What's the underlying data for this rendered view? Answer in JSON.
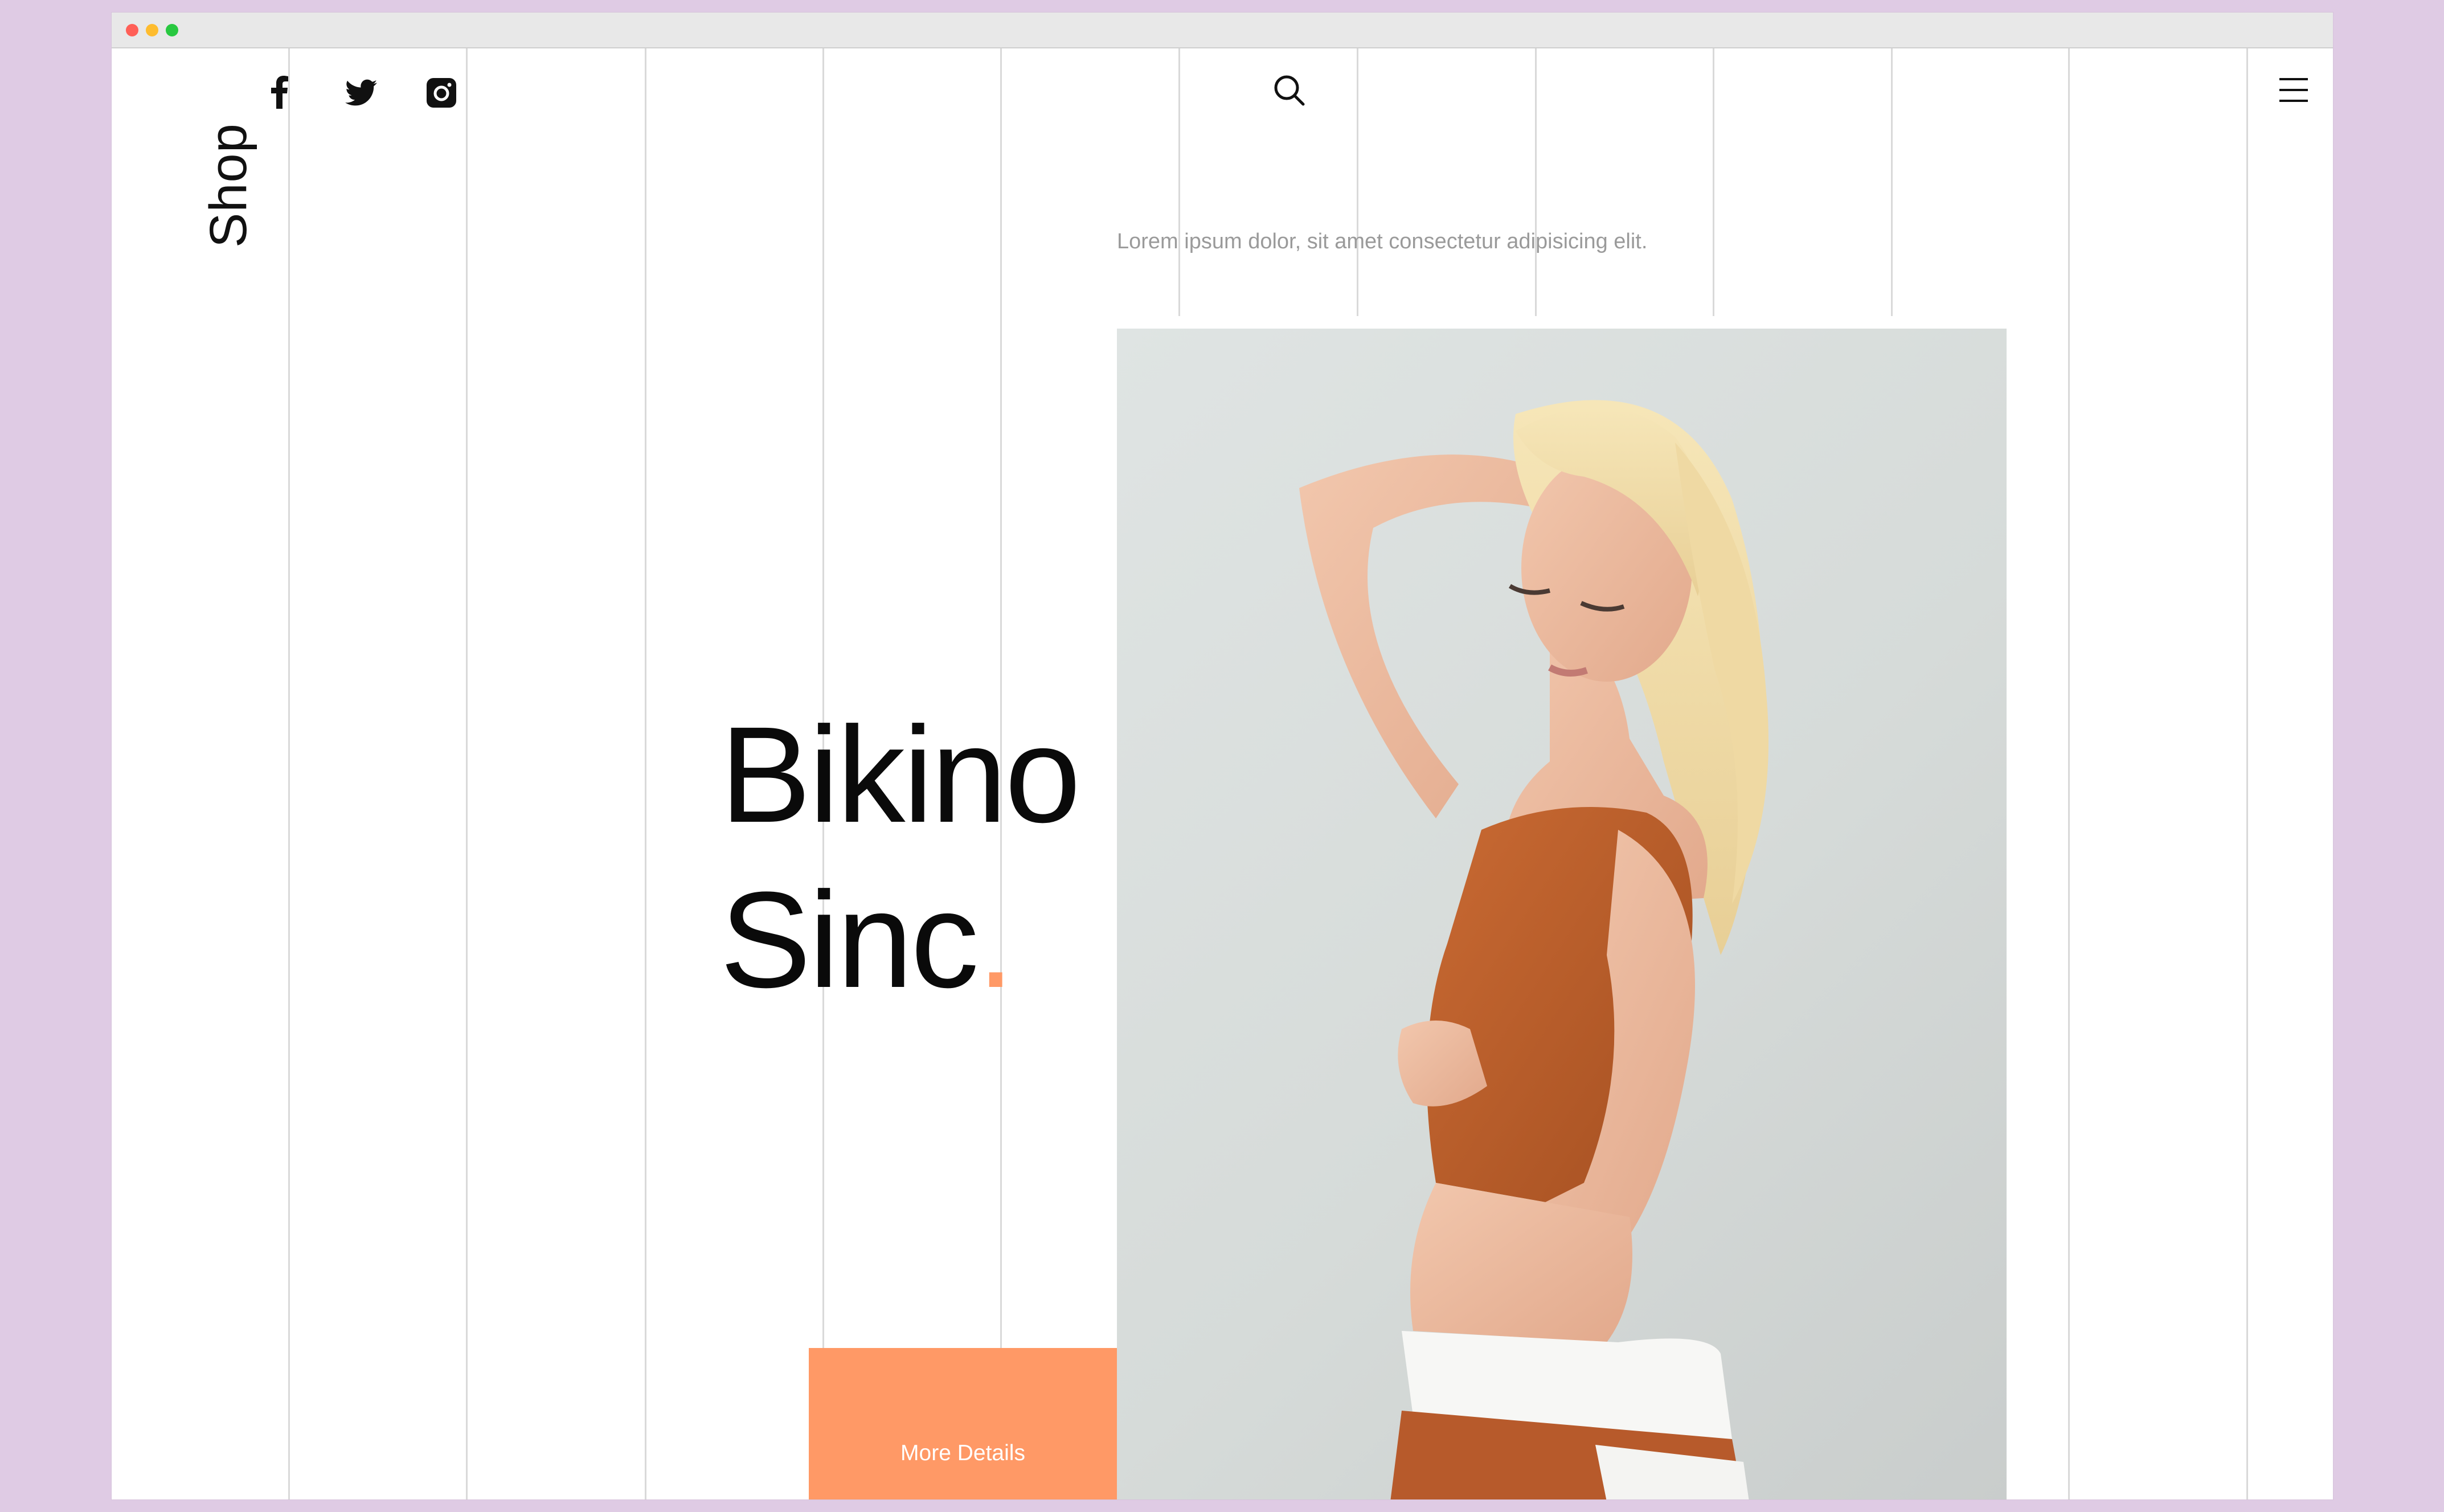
{
  "window": {
    "controls": [
      "close",
      "minimize",
      "zoom"
    ]
  },
  "header": {
    "brand": "Shop",
    "social": [
      {
        "name": "facebook-icon"
      },
      {
        "name": "twitter-icon"
      },
      {
        "name": "instagram-icon"
      }
    ],
    "search_icon": "search-icon",
    "menu_icon": "hamburger-menu-icon"
  },
  "hero": {
    "tagline": "Lorem ipsum dolor, sit amet consectetur adipisicing elit.",
    "title_line1": "Bikino",
    "title_line2": "Sinc",
    "title_dot": ".",
    "cta_label": "More Details",
    "image_alt": "Model in orange crop top and shorts"
  },
  "colors": {
    "page_background": "#dfcbe4",
    "accent": "#ff9966",
    "text": "#0a0a0a",
    "muted_text": "#9a9a9a",
    "grid_line": "#d9d9d9"
  }
}
